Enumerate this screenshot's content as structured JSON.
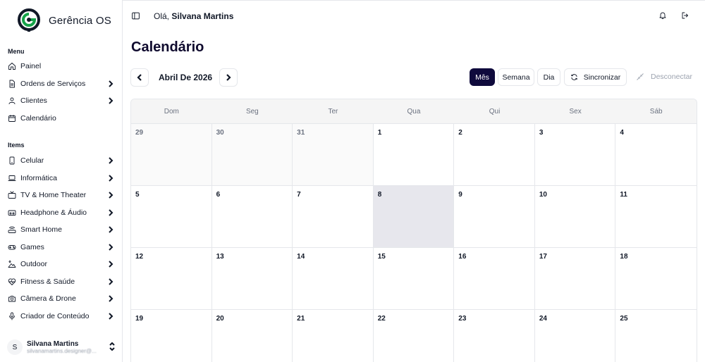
{
  "brand": {
    "name": "Gerência OS",
    "accent": "#16a34a",
    "dark": "#0f0a3c"
  },
  "sidebar": {
    "menu_label": "Menu",
    "menu_items": [
      {
        "label": "Painel",
        "icon": "home-icon",
        "chevron": false
      },
      {
        "label": "Ordens de Serviços",
        "icon": "document-icon",
        "chevron": true
      },
      {
        "label": "Clientes",
        "icon": "user-icon",
        "chevron": true
      },
      {
        "label": "Calendário",
        "icon": "calendar-icon",
        "chevron": false
      }
    ],
    "items_label": "Items",
    "items": [
      {
        "label": "Celular",
        "icon": "phone-icon"
      },
      {
        "label": "Informática",
        "icon": "laptop-icon"
      },
      {
        "label": "TV & Home Theater",
        "icon": "tv-icon"
      },
      {
        "label": "Headphone & Áudio",
        "icon": "speaker-icon"
      },
      {
        "label": "Smart Home",
        "icon": "router-icon"
      },
      {
        "label": "Games",
        "icon": "gamepad-icon"
      },
      {
        "label": "Outdoor",
        "icon": "outdoor-icon"
      },
      {
        "label": "Fitness & Saúde",
        "icon": "heart-pulse-icon"
      },
      {
        "label": "Câmera & Drone",
        "icon": "camera-icon"
      },
      {
        "label": "Criador de Conteúdo",
        "icon": "microphone-icon"
      }
    ]
  },
  "user": {
    "initial": "S",
    "name": "Silvana Martins",
    "email": "silvanamartins.designer@..."
  },
  "header": {
    "greeting": "Olá,",
    "user_name": "Silvana Martins"
  },
  "page": {
    "title": "Calendário"
  },
  "toolbar": {
    "month_label": "Abril De 2026",
    "views": [
      "Mês",
      "Semana",
      "Dia"
    ],
    "active_view": "Mês",
    "sync_label": "Sincronizar",
    "disconnect_label": "Desconectar"
  },
  "calendar": {
    "weekdays": [
      "Dom",
      "Seg",
      "Ter",
      "Qua",
      "Qui",
      "Sex",
      "Sáb"
    ],
    "weeks": [
      [
        {
          "d": "29",
          "other": true
        },
        {
          "d": "30",
          "other": true
        },
        {
          "d": "31",
          "other": true
        },
        {
          "d": "1"
        },
        {
          "d": "2"
        },
        {
          "d": "3"
        },
        {
          "d": "4"
        }
      ],
      [
        {
          "d": "5"
        },
        {
          "d": "6"
        },
        {
          "d": "7"
        },
        {
          "d": "8",
          "today": true
        },
        {
          "d": "9"
        },
        {
          "d": "10"
        },
        {
          "d": "11"
        }
      ],
      [
        {
          "d": "12"
        },
        {
          "d": "13"
        },
        {
          "d": "14"
        },
        {
          "d": "15"
        },
        {
          "d": "16"
        },
        {
          "d": "17"
        },
        {
          "d": "18"
        }
      ],
      [
        {
          "d": "19"
        },
        {
          "d": "20"
        },
        {
          "d": "21"
        },
        {
          "d": "22"
        },
        {
          "d": "23"
        },
        {
          "d": "24"
        },
        {
          "d": "25"
        }
      ]
    ]
  }
}
